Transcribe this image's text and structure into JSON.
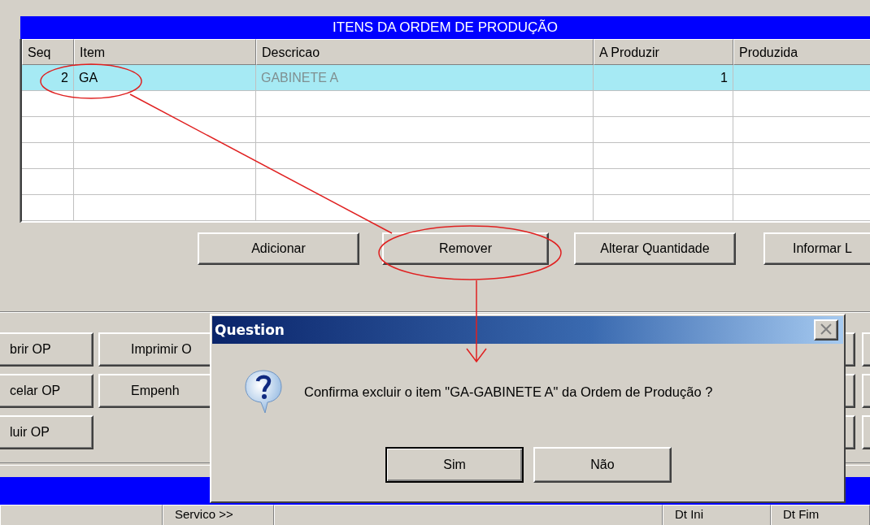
{
  "table": {
    "title": "ITENS DA ORDEM DE PRODUÇÃO",
    "columns": [
      "Seq",
      "Item",
      "Descricao",
      "A Produzir",
      "Produzida"
    ],
    "rows": [
      {
        "seq": "2",
        "item": "GA",
        "descricao": "GABINETE A",
        "a_produzir": "1",
        "selected": true
      }
    ]
  },
  "item_buttons": [
    "Adicionar",
    "Remover",
    "Alterar Quantidade",
    "Informar L"
  ],
  "op_buttons": [
    [
      "brir OP",
      "Imprimir O"
    ],
    [
      "celar OP",
      "Empenh"
    ],
    [
      "luir OP"
    ]
  ],
  "bottom_bar": [
    "Servico >>",
    "Dt Ini",
    "Dt Fim"
  ],
  "dialog": {
    "title": "Question",
    "message": "Confirma excluir o item \"GA-GABINETE A\" da Ordem de Produção ?",
    "buttons": [
      {
        "label": "Sim",
        "default": true
      },
      {
        "label": "Não",
        "default": false
      }
    ]
  },
  "annotations": [
    {
      "kind": "ellipse"
    },
    {
      "kind": "line"
    },
    {
      "kind": "ellipse"
    },
    {
      "kind": "arrow"
    }
  ]
}
